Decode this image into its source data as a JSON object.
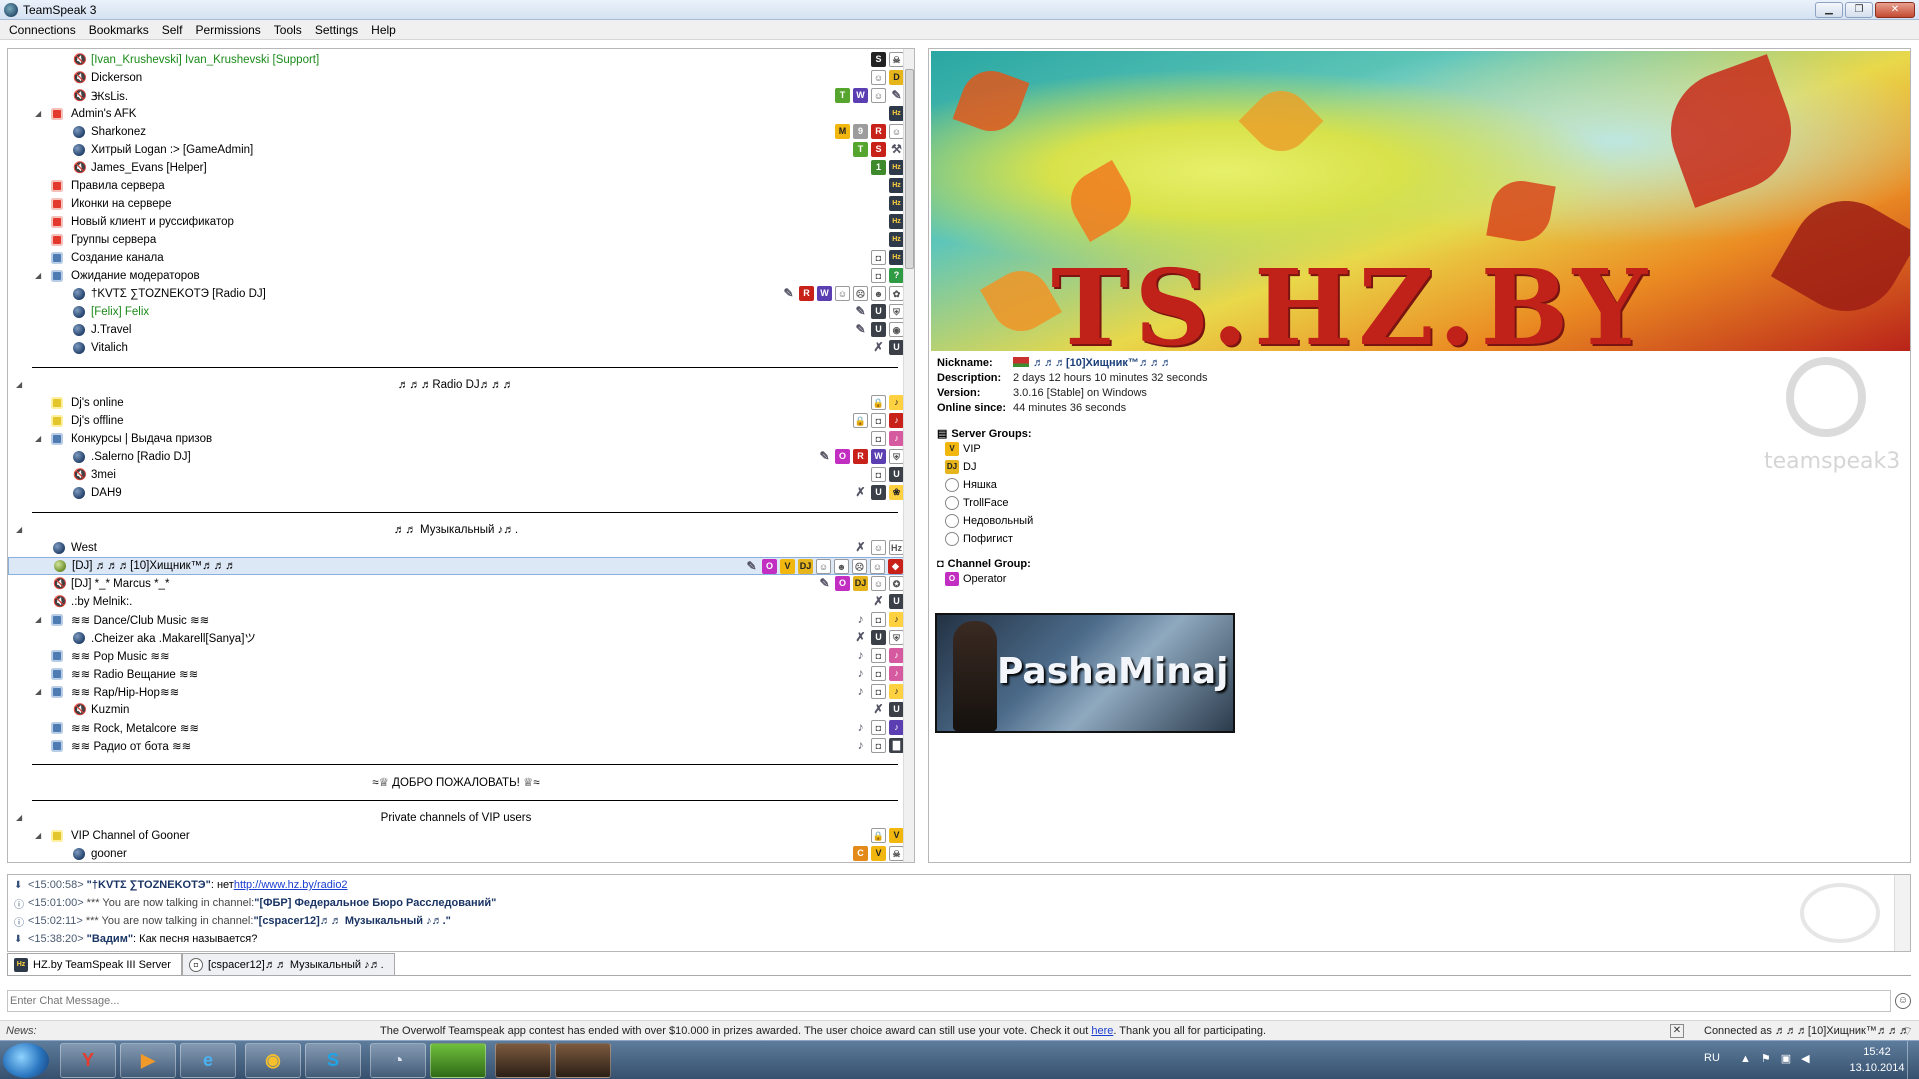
{
  "window": {
    "title": "TeamSpeak 3"
  },
  "menu": [
    "Connections",
    "Bookmarks",
    "Self",
    "Permissions",
    "Tools",
    "Settings",
    "Help"
  ],
  "tree": {
    "rows": [
      {
        "name": "[Ivan_Krushevski] Ivan_Krushevski [Support]"
      },
      {
        "name": "Dickerson"
      },
      {
        "name": "ꚄsLis."
      },
      {
        "name": "Admin's AFK"
      },
      {
        "name": "Sharkonez"
      },
      {
        "name": "Хитрый Logan :> [GameAdmin]"
      },
      {
        "name": "James_Evans [Helper]"
      },
      {
        "name": "Правила сервера"
      },
      {
        "name": "Иконки на сервере"
      },
      {
        "name": "Новый клиент и руссификатор"
      },
      {
        "name": "Группы сервера"
      },
      {
        "name": "Создание канала"
      },
      {
        "name": "Ожидание модераторов"
      },
      {
        "name": "†KVTΣ ∑TOZNEKOTЭ [Radio DJ]"
      },
      {
        "name": "[Felix] Felix"
      },
      {
        "name": "J.Travel"
      },
      {
        "name": "Vitalich"
      },
      {
        "name": "♬♬♬Radio DJ♬♬♬"
      },
      {
        "name": "Dj's online"
      },
      {
        "name": "Dj's offline"
      },
      {
        "name": "Конкурсы | Выдача призов"
      },
      {
        "name": ".Salerno [Radio DJ]"
      },
      {
        "name": "3mei"
      },
      {
        "name": "DAH9"
      },
      {
        "name": "♬♬ Музыкальный ♪♬."
      },
      {
        "name": "West"
      },
      {
        "name": "[DJ] ♬♬♬[10]Хищник™♬♬♬"
      },
      {
        "name": "[DJ] *_* Marcus *_*"
      },
      {
        "name": ".:by Melnik:."
      },
      {
        "name": "≋≋ Dance/Club Music ≋≋"
      },
      {
        "name": ".Cheizer aka .Makarell[Sanya]ツ"
      },
      {
        "name": "≋≋ Pop Music ≋≋"
      },
      {
        "name": "≋≋ Radio Вещание ≋≋"
      },
      {
        "name": "≋≋ Rap/Hip-Hop≋≋"
      },
      {
        "name": "Kuzmin"
      },
      {
        "name": "≋≋ Rock, Metalcore ≋≋"
      },
      {
        "name": "≋≋ Радио от бота  ≋≋"
      },
      {
        "name": "≈♕ ДОБРО ПОЖАЛОВАТЬ! ♕≈"
      },
      {
        "name": "Private channels of VIP users"
      },
      {
        "name": "VIP Channel of Gooner"
      },
      {
        "name": "gooner"
      }
    ]
  },
  "info": {
    "banner_text": "TS.HZ.BY",
    "labels": {
      "nickname": "Nickname:",
      "description": "Description:",
      "version": "Version:",
      "online": "Online since:"
    },
    "nickname": "♬♬♬[10]Хищник™♬♬♬",
    "description": "2 days 12 hours 10 minutes 32 seconds",
    "version": "3.0.16 [Stable] on Windows",
    "online_since": "44 minutes 36 seconds",
    "server_groups_label": "Server Groups:",
    "server_groups": [
      "VIP",
      "DJ",
      "Няшка",
      "TrollFace",
      "Недовольный",
      "Пофигист"
    ],
    "channel_group_label": "Channel Group:",
    "channel_group": "Operator",
    "logo_word": "teamspeak3",
    "signature_text": "PashaMinaj"
  },
  "chat": {
    "lines": [
      {
        "ts": "<15:00:58>",
        "who": "\"†KVTΣ ∑TOZNEKOTЭ\"",
        "text": ": нет ",
        "link": "http://www.hz.by/radio2"
      },
      {
        "ts": "<15:01:00>",
        "sys": "*** You are now talking in channel: ",
        "chan": "\"[ФБР] Федеральное Бюро Расследований\""
      },
      {
        "ts": "<15:02:11>",
        "sys": "*** You are now talking in channel: ",
        "chan": "\"[cspacer12]♬♬ Музыкальный ♪♬.\""
      },
      {
        "ts": "<15:38:20>",
        "who": "\"Вадим\"",
        "text": ": Как песня называется?"
      }
    ]
  },
  "tabs": [
    "HZ.by TeamSpeak III Server",
    "[cspacer12]♬♬ Музыкальный ♪♬."
  ],
  "input": {
    "placeholder": "Enter Chat Message..."
  },
  "status": {
    "news_label": "News:",
    "ticker_pre": "The Overwolf Teamspeak app contest has ended with over $10.000 in prizes awarded. The user choice award can still use your vote. Check it out ",
    "ticker_link": "here",
    "ticker_post": ". Thank you all for participating.",
    "connected": "Connected as ♬♬♬[10]Хищник™♬♬♬"
  },
  "taskbar": {
    "lang": "RU",
    "time": "15:42",
    "date": "13.10.2014"
  }
}
